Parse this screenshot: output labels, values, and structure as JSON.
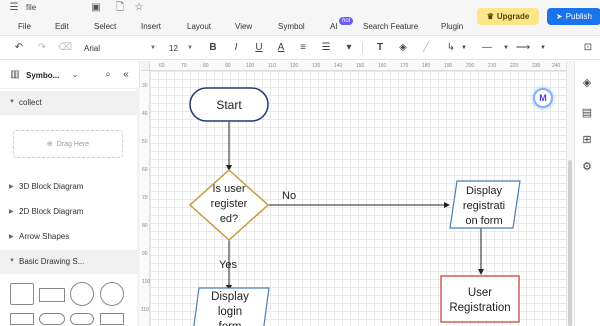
{
  "titlebar": {
    "file_name": "file"
  },
  "menu": {
    "items": [
      "File",
      "Edit",
      "Select",
      "Insert",
      "Layout",
      "View",
      "Symbol",
      "AI",
      "Search Feature",
      "Plugin"
    ],
    "hot_badge": "hot",
    "upgrade_label": "Upgrade",
    "publish_label": "Publish"
  },
  "toolbar": {
    "font_family": "Arial",
    "font_size": "12"
  },
  "left_panel": {
    "title": "Symbo...",
    "collect_label": "collect",
    "drag_here": "Drag Here",
    "categories": [
      "3D Block Diagram",
      "2D Block Diagram",
      "Arrow Shapes",
      "Basic Drawing S..."
    ]
  },
  "ruler": {
    "top": [
      "60",
      "70",
      "80",
      "90",
      "100",
      "110",
      "120",
      "130",
      "140",
      "150",
      "160",
      "170",
      "180",
      "190",
      "200",
      "210",
      "220",
      "230",
      "240"
    ],
    "left": [
      "30",
      "40",
      "50",
      "60",
      "70",
      "80",
      "90",
      "100",
      "110"
    ]
  },
  "flowchart": {
    "start": "Start",
    "decision": [
      "Is user",
      "register",
      "ed?"
    ],
    "no_label": "No",
    "yes_label": "Yes",
    "display_form": [
      "Display",
      "registrati",
      "on form"
    ],
    "user_registration": [
      "User",
      "Registration"
    ],
    "display_login": [
      "Display",
      "login",
      "form"
    ]
  },
  "colors": {
    "accent_blue": "#1a73e8",
    "upgrade_yellow": "#fde58a",
    "terminal_stroke": "#1f3b73",
    "decision_stroke": "#c89a3c",
    "io_stroke": "#4a7fb5",
    "process_stroke": "#c0392b"
  }
}
